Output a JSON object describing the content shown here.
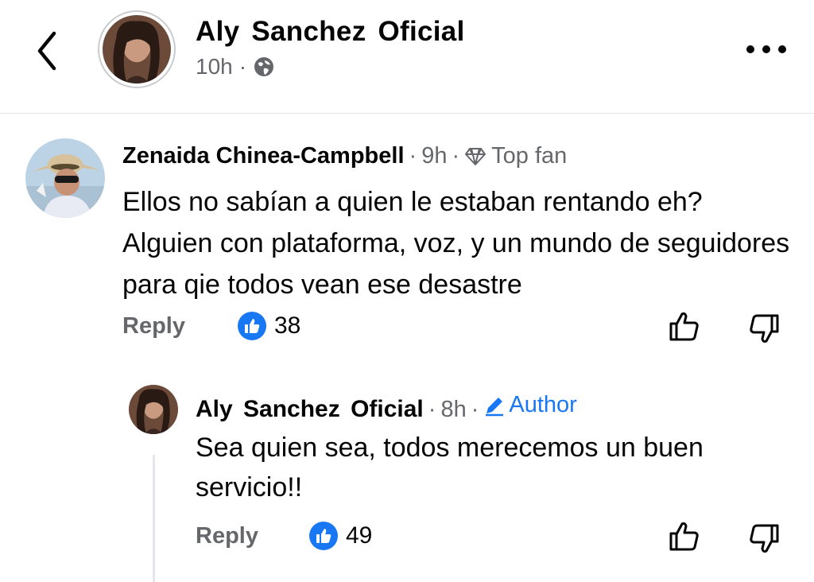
{
  "header": {
    "page_name": "Aly  Sanchez  Oficial",
    "time": "10h",
    "separator": "·",
    "icons": {
      "back": "chevron-left-icon",
      "privacy": "globe-icon",
      "more": "more-dots-icon"
    }
  },
  "comment": {
    "author": "Zenaida Chinea-Campbell",
    "separator": "·",
    "time": "9h",
    "badge": "Top fan",
    "badge_icon": "diamond-icon",
    "text": "Ellos no sabían a quien le estaban rentando eh? Alguien con plataforma, voz, y un mundo de seguidores para qie todos vean ese desastre",
    "reply_label": "Reply",
    "like_count": "38"
  },
  "reply": {
    "author": "Aly  Sanchez  Oficial",
    "separator": "·",
    "time": "8h",
    "badge": "Author",
    "badge_icon": "pencil-icon",
    "text": "Sea quien sea, todos merecemos un buen servicio!!",
    "reply_label": "Reply",
    "like_count": "49"
  },
  "colors": {
    "accent": "#1877f2",
    "muted": "#65676b",
    "text": "#050505",
    "divider": "#e4e6eb"
  }
}
